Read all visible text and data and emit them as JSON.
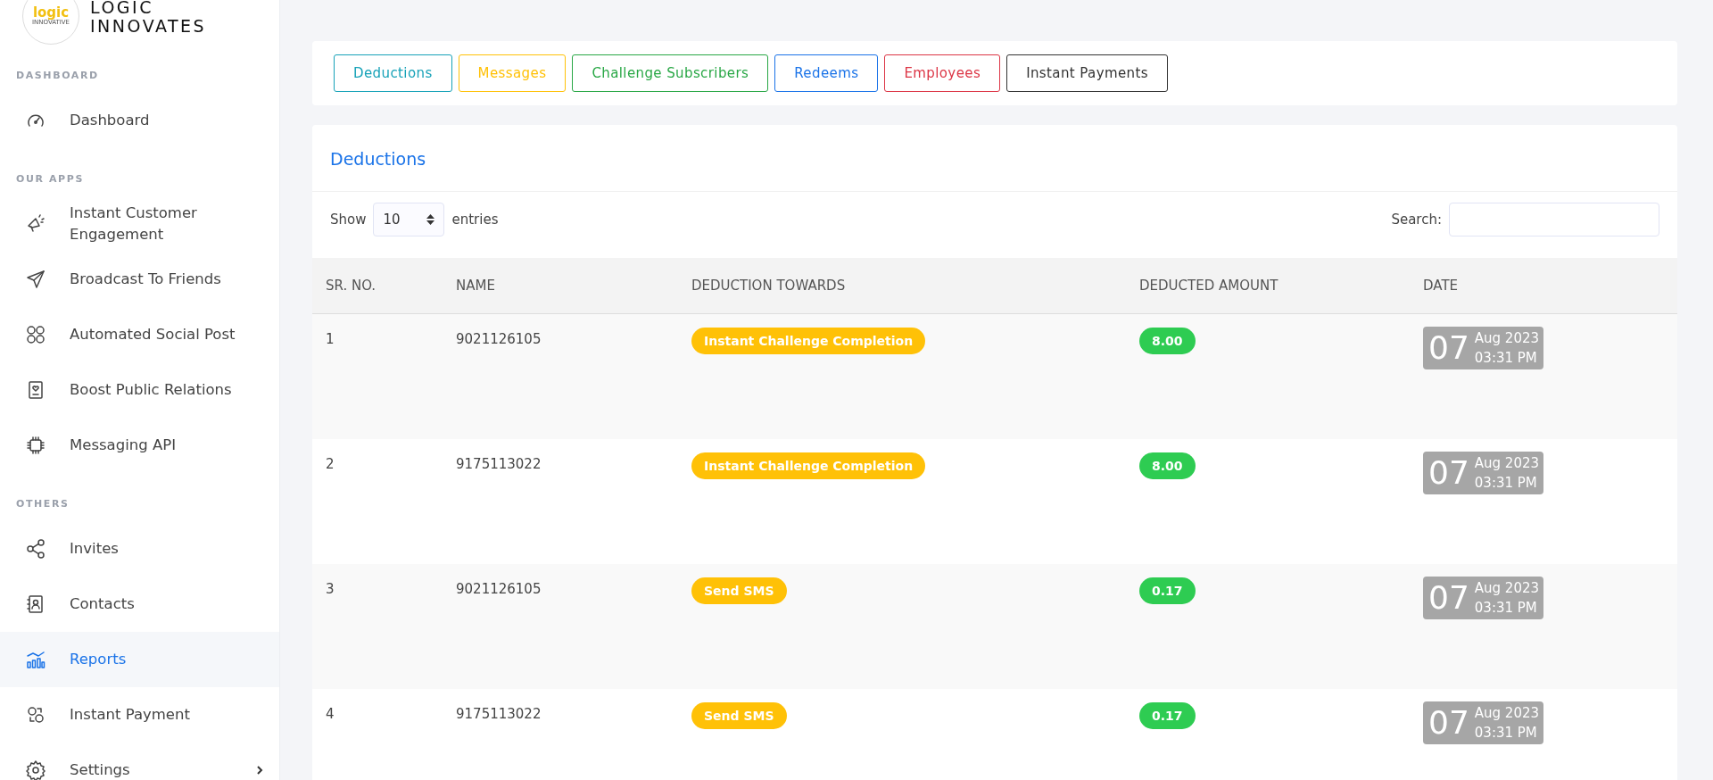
{
  "brand": {
    "logo_word": "logic",
    "logo_sub": "INNOVATIVE",
    "name_line1": "LOGIC",
    "name_line2": "INNOVATES"
  },
  "sidebar": {
    "sections": [
      {
        "label": "DASHBOARD",
        "items": [
          {
            "label": "Dashboard",
            "selected": false,
            "submenu": false
          }
        ]
      },
      {
        "label": "OUR APPS",
        "items": [
          {
            "label": "Instant Customer Engagement",
            "selected": false,
            "submenu": false
          },
          {
            "label": "Broadcast To Friends",
            "selected": false,
            "submenu": false
          },
          {
            "label": "Automated Social Post",
            "selected": false,
            "submenu": false
          },
          {
            "label": "Boost Public Relations",
            "selected": false,
            "submenu": false
          },
          {
            "label": "Messaging API",
            "selected": false,
            "submenu": false
          }
        ]
      },
      {
        "label": "OTHERS",
        "items": [
          {
            "label": "Invites",
            "selected": false,
            "submenu": false
          },
          {
            "label": "Contacts",
            "selected": false,
            "submenu": false
          },
          {
            "label": "Reports",
            "selected": true,
            "submenu": false
          },
          {
            "label": "Instant Payment",
            "selected": false,
            "submenu": false
          },
          {
            "label": "Settings",
            "selected": false,
            "submenu": true
          }
        ]
      }
    ]
  },
  "tabs": [
    {
      "label": "Deductions",
      "color": "#17a2b8"
    },
    {
      "label": "Messages",
      "color": "#ffc107"
    },
    {
      "label": "Challenge Subscribers",
      "color": "#28a745"
    },
    {
      "label": "Redeems",
      "color": "#1a73e8"
    },
    {
      "label": "Employees",
      "color": "#dc3545"
    },
    {
      "label": "Instant Payments",
      "color": "#333333"
    }
  ],
  "table_card": {
    "title": "Deductions",
    "show_label": "Show",
    "page_size": "10",
    "entries_label": "entries",
    "search_label": "Search:",
    "columns": [
      "SR. NO.",
      "NAME",
      "DEDUCTION TOWARDS",
      "DEDUCTED AMOUNT",
      "DATE"
    ],
    "rows": [
      {
        "sr_no": "1",
        "name": "9021126105",
        "deduction_towards": "Instant Challenge Completion",
        "amount": "8.00",
        "day": "07",
        "month_year": "Aug 2023",
        "time": "03:31 PM"
      },
      {
        "sr_no": "2",
        "name": "9175113022",
        "deduction_towards": "Instant Challenge Completion",
        "amount": "8.00",
        "day": "07",
        "month_year": "Aug 2023",
        "time": "03:31 PM"
      },
      {
        "sr_no": "3",
        "name": "9021126105",
        "deduction_towards": "Send SMS",
        "amount": "0.17",
        "day": "07",
        "month_year": "Aug 2023",
        "time": "03:31 PM"
      },
      {
        "sr_no": "4",
        "name": "9175113022",
        "deduction_towards": "Send SMS",
        "amount": "0.17",
        "day": "07",
        "month_year": "Aug 2023",
        "time": "03:31 PM"
      }
    ]
  }
}
